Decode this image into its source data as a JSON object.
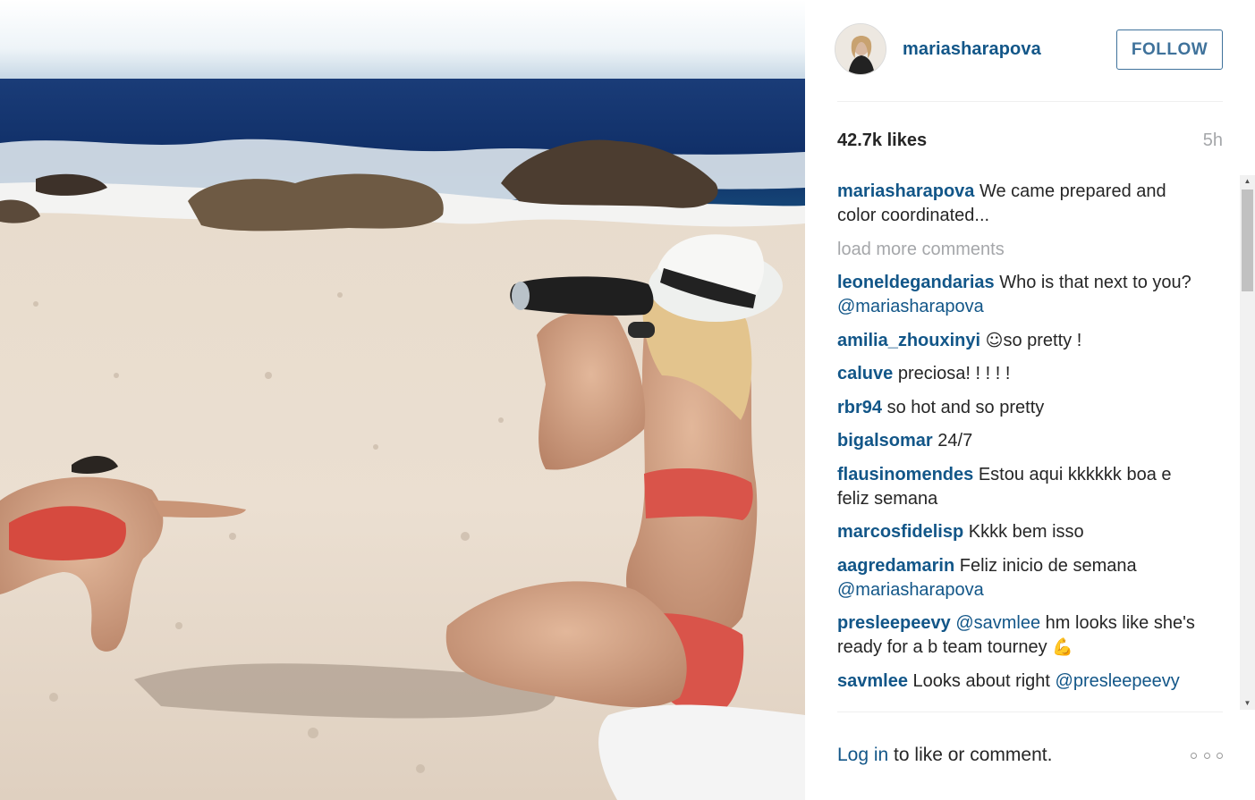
{
  "post": {
    "username": "mariasharapova",
    "follow_label": "FOLLOW",
    "likes": "42.7k likes",
    "time": "5h",
    "caption": {
      "user": "mariasharapova",
      "text": "We came prepared and color coordinated..."
    },
    "load_more": "load more comments",
    "comments": [
      {
        "user": "leoneldegandarias",
        "parts": [
          {
            "t": "Who is that next to you? "
          },
          {
            "t": "@mariasharapova",
            "m": true
          }
        ]
      },
      {
        "user": "amilia_zhouxinyi",
        "parts": [
          {
            "t": "☺",
            "e": true
          },
          {
            "t": "so pretty !"
          }
        ]
      },
      {
        "user": "caluve",
        "parts": [
          {
            "t": "preciosa! ! ! ! !"
          }
        ]
      },
      {
        "user": "rbr94",
        "parts": [
          {
            "t": "so hot and so pretty"
          }
        ]
      },
      {
        "user": "bigalsomar",
        "parts": [
          {
            "t": "24/7"
          }
        ]
      },
      {
        "user": "flausinomendes",
        "parts": [
          {
            "t": "Estou aqui kkkkkk boa e feliz semana"
          }
        ]
      },
      {
        "user": "marcosfidelisp",
        "parts": [
          {
            "t": "Kkkk bem isso"
          }
        ]
      },
      {
        "user": "aagredamarin",
        "parts": [
          {
            "t": "Feliz inicio de semana "
          },
          {
            "t": "@mariasharapova",
            "m": true
          }
        ]
      },
      {
        "user": "presleepeevy",
        "parts": [
          {
            "t": "@savmlee",
            "m": true
          },
          {
            "t": " hm looks like she's ready for a b team tourney "
          },
          {
            "t": "💪",
            "e": true
          }
        ]
      },
      {
        "user": "savmlee",
        "parts": [
          {
            "t": "Looks about right "
          },
          {
            "t": "@presleepeevy",
            "m": true
          }
        ]
      }
    ],
    "footer": {
      "login": "Log in",
      "rest": " to like or comment."
    }
  },
  "icons": {
    "avatar": "profile-avatar",
    "more": "more-options-icon",
    "scroll_up": "scroll-up-arrow",
    "scroll_down": "scroll-down-arrow"
  },
  "colors": {
    "link": "#125688",
    "follow": "#3f729b",
    "muted": "#a5a7aa",
    "text": "#262626"
  }
}
